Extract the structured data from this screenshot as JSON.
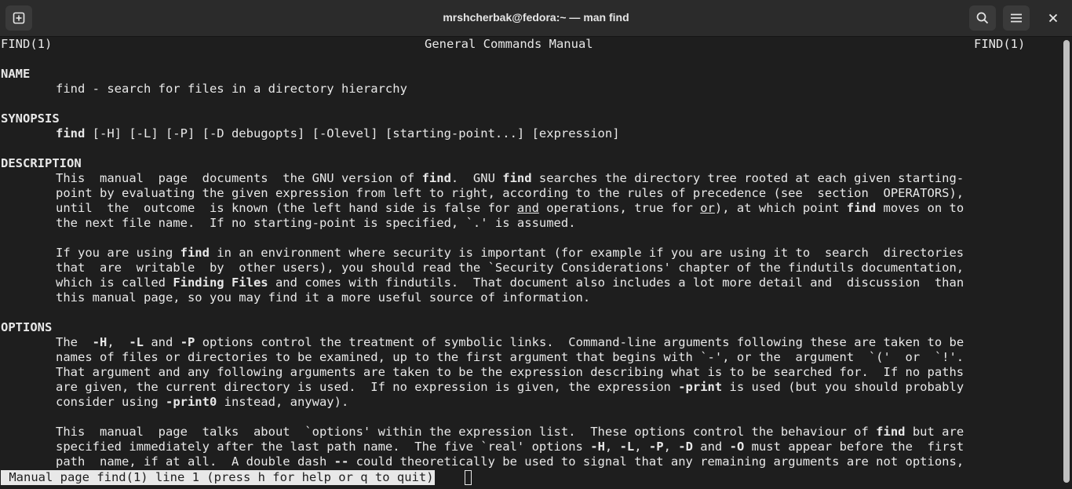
{
  "window": {
    "title": "mrshcherbak@fedora:~ — man find",
    "new_tab_icon": "new-tab-icon",
    "search_icon": "search-icon",
    "menu_icon": "hamburger-menu-icon",
    "close_icon": "close-icon"
  },
  "terminal": {
    "header_left": "FIND(1)",
    "header_center": "General Commands Manual",
    "header_right": "FIND(1)",
    "name_heading": "NAME",
    "name_text": "find - search for files in a directory hierarchy",
    "synopsis_heading": "SYNOPSIS",
    "synopsis_cmd": "find",
    "synopsis_args": " [-H] [-L] [-P] [-D debugopts] [-Olevel] [starting-point...] [expression]",
    "description_heading": "DESCRIPTION",
    "desc": {
      "l1a": "This  manual  page  documents  the GNU version of ",
      "l1b": "find",
      "l1c": ".  GNU ",
      "l1d": "find",
      "l1e": " searches the directory tree rooted at each given starting-",
      "l2": "point by evaluating the given expression from left to right, according to the rules of precedence (see  section  OPERATORS),",
      "l3a": "until  the  outcome  is known (the left hand side is false for ",
      "l3b": "and",
      "l3c": " operations, true for ",
      "l3d": "or",
      "l3e": "), at which point ",
      "l3f": "find",
      "l3g": " moves on to",
      "l4": "the next file name.  If no starting-point is specified, `.' is assumed.",
      "l5a": "If you are using ",
      "l5b": "find",
      "l5c": " in an environment where security is important (for example if you are using it to  search  directories",
      "l6": "that  are  writable  by  other users), you should read the `Security Considerations' chapter of the findutils documentation,",
      "l7a": "which is called ",
      "l7b": "Finding Files",
      "l7c": " and comes with findutils.  That document also includes a lot more detail and  discussion  than",
      "l8": "this manual page, so you may find it a more useful source of information."
    },
    "options_heading": "OPTIONS",
    "opts": {
      "l1a": "The  ",
      "l1b": "-H",
      "l1c": ",  ",
      "l1d": "-L",
      "l1e": " and ",
      "l1f": "-P",
      "l1g": " options control the treatment of symbolic links.  Command-line arguments following these are taken to be",
      "l2": "names of files or directories to be examined, up to the first argument that begins with `-', or the  argument  `('  or  `!'.",
      "l3": "That argument and any following arguments are taken to be the expression describing what is to be searched for.  If no paths",
      "l4a": "are given, the current directory is used.  If no expression is given, the expression ",
      "l4b": "-print",
      "l4c": " is used (but you should probably",
      "l5a": "consider using ",
      "l5b": "-print0",
      "l5c": " instead, anyway).",
      "l6a": "This  manual  page  talks  about  `options' within the expression list.  These options control the behaviour of ",
      "l6b": "find",
      "l6c": " but are",
      "l7a": "specified immediately after the last path name.  The five `real' options ",
      "l7b": "-H",
      "l7c": ", ",
      "l7d": "-L",
      "l7e": ", ",
      "l7f": "-P",
      "l7g": ", ",
      "l7h": "-D",
      "l7i": " and ",
      "l7j": "-O",
      "l7k": " must appear before the  first",
      "l8a": "path  name, if at all.  A double dash ",
      "l8b": "--",
      "l8c": " could theoretically be used to signal that any remaining arguments are not options,"
    },
    "status_line": " Manual page find(1) line 1 (press h for help or q to quit)"
  }
}
